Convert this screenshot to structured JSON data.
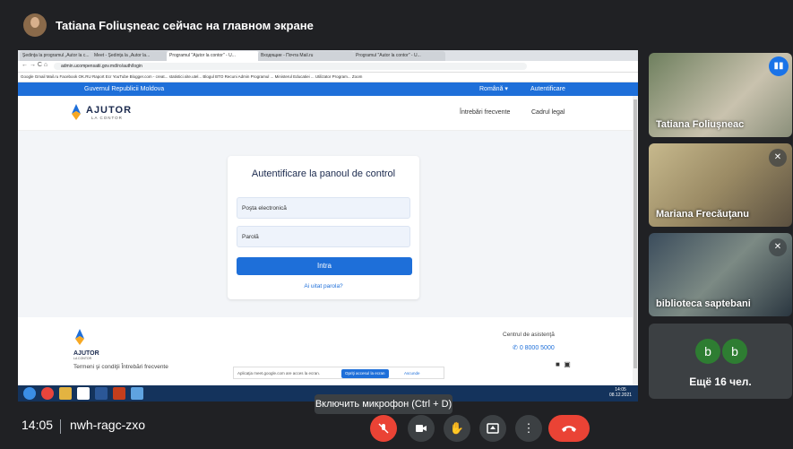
{
  "banner": {
    "text": "Tatiana Foliuşneac сейчас на главном экране"
  },
  "browser": {
    "tabs": [
      "Şedinţa la programul „Autor la c...",
      "Meet - Şedinţa la „Autor la...",
      "Programul \"Ajutor la contor\" - U...",
      "Входящие - Почта Mail.ru",
      "Programul \"Autor la contor\" - U..."
    ],
    "url": "admin.ucompensatii.gov.md/ro/auth/login",
    "bookmarks": "Google  Gmail  Mail.ru  Facebook  OK.RU  Raport Ecr  YouTube  Blogger.com - creat...  statistici.site.utel...  Blogul BTO Recuni  Admin Programul ...  Ministerul Educatiei ...  Utilizator Program...  Zoom"
  },
  "site": {
    "gov_label": "Guvernul Republicii Moldova",
    "lang": "Română ▾",
    "auth": "Autentificare",
    "logo_main": "AJUTOR",
    "logo_sub": "LA CONTOR",
    "nav_faq": "Întrebări frecvente",
    "nav_legal": "Cadrul legal",
    "login_title": "Autentificare la panoul de control",
    "email_placeholder": "Poşta electronică",
    "password_placeholder": "Parolă",
    "submit": "Intra",
    "forgot": "Ai uitat parola?",
    "footer_links": "Termeni şi condiţii   Întrebări frecvente",
    "support_label": "Centrul de asistenţă",
    "support_phone": "0 8000 5000",
    "notif_text": "Aplicaţia meet.google.com are acces la ecran.",
    "notif_stop": "Opriţi accesul la ecran",
    "notif_hide": "Ascunde",
    "taskbar_time": "14:05",
    "taskbar_date": "08.12.2021"
  },
  "participants": [
    {
      "name": "Tatiana Foliuşneac",
      "speaking": true
    },
    {
      "name": "Mariana Frecăuţanu",
      "muted": true
    },
    {
      "name": "biblioteca saptebani",
      "muted": true
    }
  ],
  "more": {
    "avatars": [
      "b",
      "b"
    ],
    "label": "Ещё 16 чел."
  },
  "tooltip": "Включить микрофон (Ctrl + D)",
  "meeting": {
    "time": "14:05",
    "code": "nwh-ragc-zxo"
  },
  "colors": {
    "accent": "#1e6fd9",
    "danger": "#ea4335",
    "bg": "#202124"
  }
}
